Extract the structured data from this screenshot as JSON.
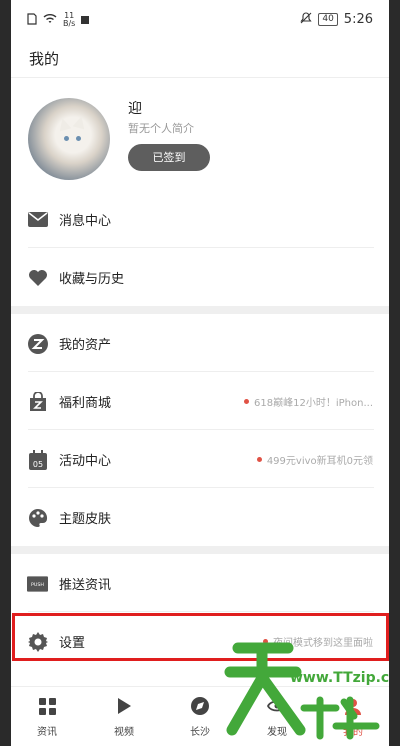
{
  "status_bar": {
    "net_speed": "11\nB/s",
    "battery": "40",
    "time": "5:26"
  },
  "header": {
    "title": "我的"
  },
  "profile": {
    "name": "迎",
    "bio": "暂无个人简介",
    "checkin_label": "已签到"
  },
  "menu": {
    "messages": {
      "label": "消息中心",
      "icon": "mail-icon"
    },
    "favorites": {
      "label": "收藏与历史",
      "icon": "heart-icon"
    },
    "assets": {
      "label": "我的资产",
      "icon": "z-coin-icon"
    },
    "mall": {
      "label": "福利商城",
      "tip": "618巅峰12小时！iPhon...",
      "icon": "shopping-bag-icon"
    },
    "events": {
      "label": "活动中心",
      "tip": "499元vivo新耳机0元领",
      "icon": "calendar-icon"
    },
    "themes": {
      "label": "主题皮肤",
      "icon": "palette-icon"
    },
    "push": {
      "label": "推送资讯",
      "icon": "push-icon"
    },
    "settings": {
      "label": "设置",
      "tip": "夜间模式移到这里面啦",
      "icon": "gear-icon"
    }
  },
  "bottom_nav": [
    {
      "label": "资讯",
      "icon": "grid-icon"
    },
    {
      "label": "视频",
      "icon": "play-icon"
    },
    {
      "label": "长沙",
      "icon": "compass-icon"
    },
    {
      "label": "发现",
      "icon": "eye-icon"
    },
    {
      "label": "我的",
      "icon": "user-icon",
      "active": true
    }
  ],
  "watermark": {
    "text": "www.TTzip.com",
    "glyph": "天下载"
  },
  "colors": {
    "accent": "#e05245",
    "highlight_border": "#e01e1e",
    "watermark": "#43a83a"
  }
}
